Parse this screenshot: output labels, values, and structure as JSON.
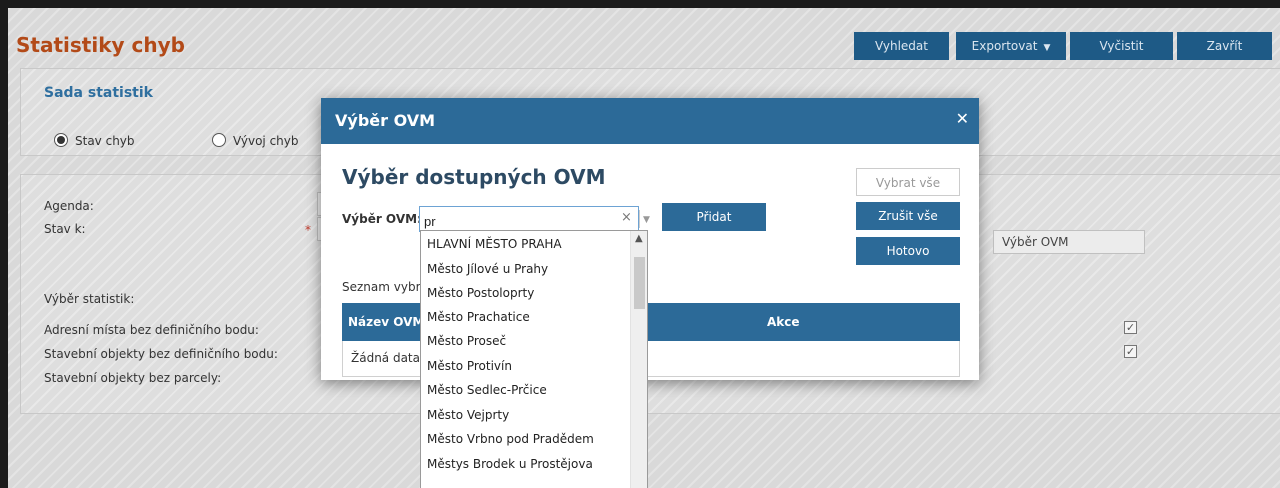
{
  "page": {
    "title": "Statistiky chyb",
    "toolbar": {
      "search": "Vyhledat",
      "export": "Exportovat",
      "clear": "Vyčistit",
      "close": "Zavřít"
    }
  },
  "stats_set": {
    "title": "Sada statistik",
    "options": [
      {
        "label": "Stav chyb",
        "selected": true
      },
      {
        "label": "Vývoj chyb",
        "selected": false
      }
    ]
  },
  "form": {
    "agenda_label": "Agenda:",
    "state_label": "Stav k:",
    "required_mark": "*",
    "select_ovm_button": "Výběr OVM",
    "stats_heading": "Výběr statistik:",
    "stats": [
      {
        "label": "Adresní místa bez definičního bodu:",
        "checked": true
      },
      {
        "label": "Stavební objekty bez definičního bodu:",
        "checked": true
      },
      {
        "label": "Stavební objekty bez parcely:",
        "checked": false
      }
    ]
  },
  "modal": {
    "title": "Výběr OVM",
    "subtitle": "Výběr dostupných OVM",
    "select_all": "Vybrat vše",
    "deselect_all": "Zrušit vše",
    "done": "Hotovo",
    "ovm_label": "Výběr OVM:",
    "ovm_value": "pr",
    "add": "Přidat",
    "list_label": "Seznam vybra",
    "table_headers": [
      "Název OVM",
      "Akce"
    ],
    "no_data": "Žádná data"
  },
  "dropdown": {
    "items": [
      "HLAVNÍ MĚSTO PRAHA",
      "Město Jílové u Prahy",
      "Město Postoloprty",
      "Město Prachatice",
      "Město Proseč",
      "Město Protivín",
      "Město Sedlec-Prčice",
      "Město Vejprty",
      "Město Vrbno pod Pradědem",
      "Městys Brodek u Prostějova"
    ]
  },
  "icons": {
    "close": "close-icon",
    "clear": "clear-icon",
    "dropdown": "chevron-down-icon",
    "scroll_up": "chevron-up-icon"
  },
  "colors": {
    "primary": "#2c6a98",
    "title_orange": "#b34a18"
  }
}
